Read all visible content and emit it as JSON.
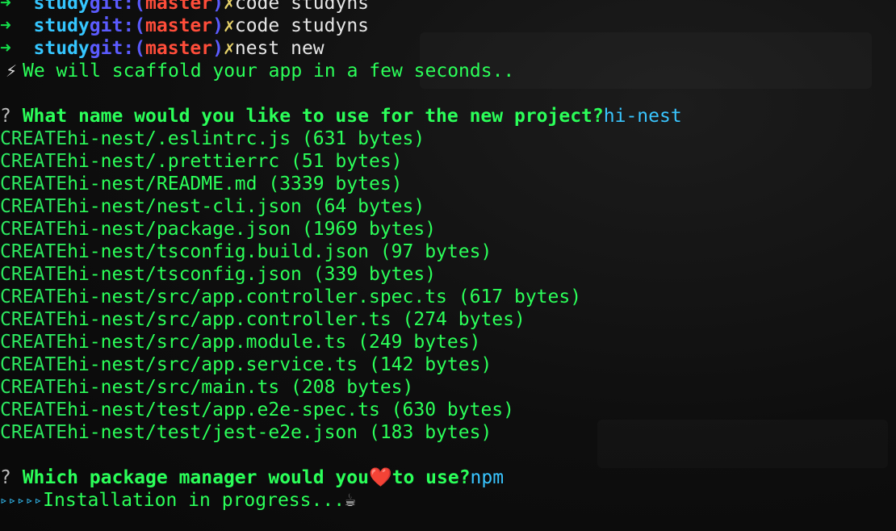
{
  "prompt": {
    "dir": "study",
    "git": "git:",
    "branch": "master",
    "dirty": "✗"
  },
  "history": [
    "code studyns",
    "code studyns",
    "nest new"
  ],
  "scaffold_msg": "We will scaffold your app in a few seconds..",
  "name_question": "What name would you like to use for the new project?",
  "name_answer": "hi-nest",
  "create_label": "CREATE",
  "files": [
    "hi-nest/.eslintrc.js (631 bytes)",
    "hi-nest/.prettierrc (51 bytes)",
    "hi-nest/README.md (3339 bytes)",
    "hi-nest/nest-cli.json (64 bytes)",
    "hi-nest/package.json (1969 bytes)",
    "hi-nest/tsconfig.build.json (97 bytes)",
    "hi-nest/tsconfig.json (339 bytes)",
    "hi-nest/src/app.controller.spec.ts (617 bytes)",
    "hi-nest/src/app.controller.ts (274 bytes)",
    "hi-nest/src/app.module.ts (249 bytes)",
    "hi-nest/src/app.service.ts (142 bytes)",
    "hi-nest/src/main.ts (208 bytes)",
    "hi-nest/test/app.e2e-spec.ts (630 bytes)",
    "hi-nest/test/jest-e2e.json (183 bytes)"
  ],
  "pm_question_pre": "Which package manager would you",
  "pm_question_post": "to use?",
  "pm_answer": "npm",
  "progress_arrows": "▹▹▹▹▹",
  "progress_text": "Installation in progress...",
  "icons": {
    "prompt_arrow": "➜",
    "bolt": "⚡",
    "heart": "❤️",
    "coffee": "☕",
    "question_mark": "?"
  },
  "colors": {
    "background": "#0e0e0e",
    "green": "#2bff59",
    "cyan": "#35c6ff",
    "blue": "#5b5bff",
    "red": "#ff4d3a",
    "yellow": "#e8d36a"
  }
}
